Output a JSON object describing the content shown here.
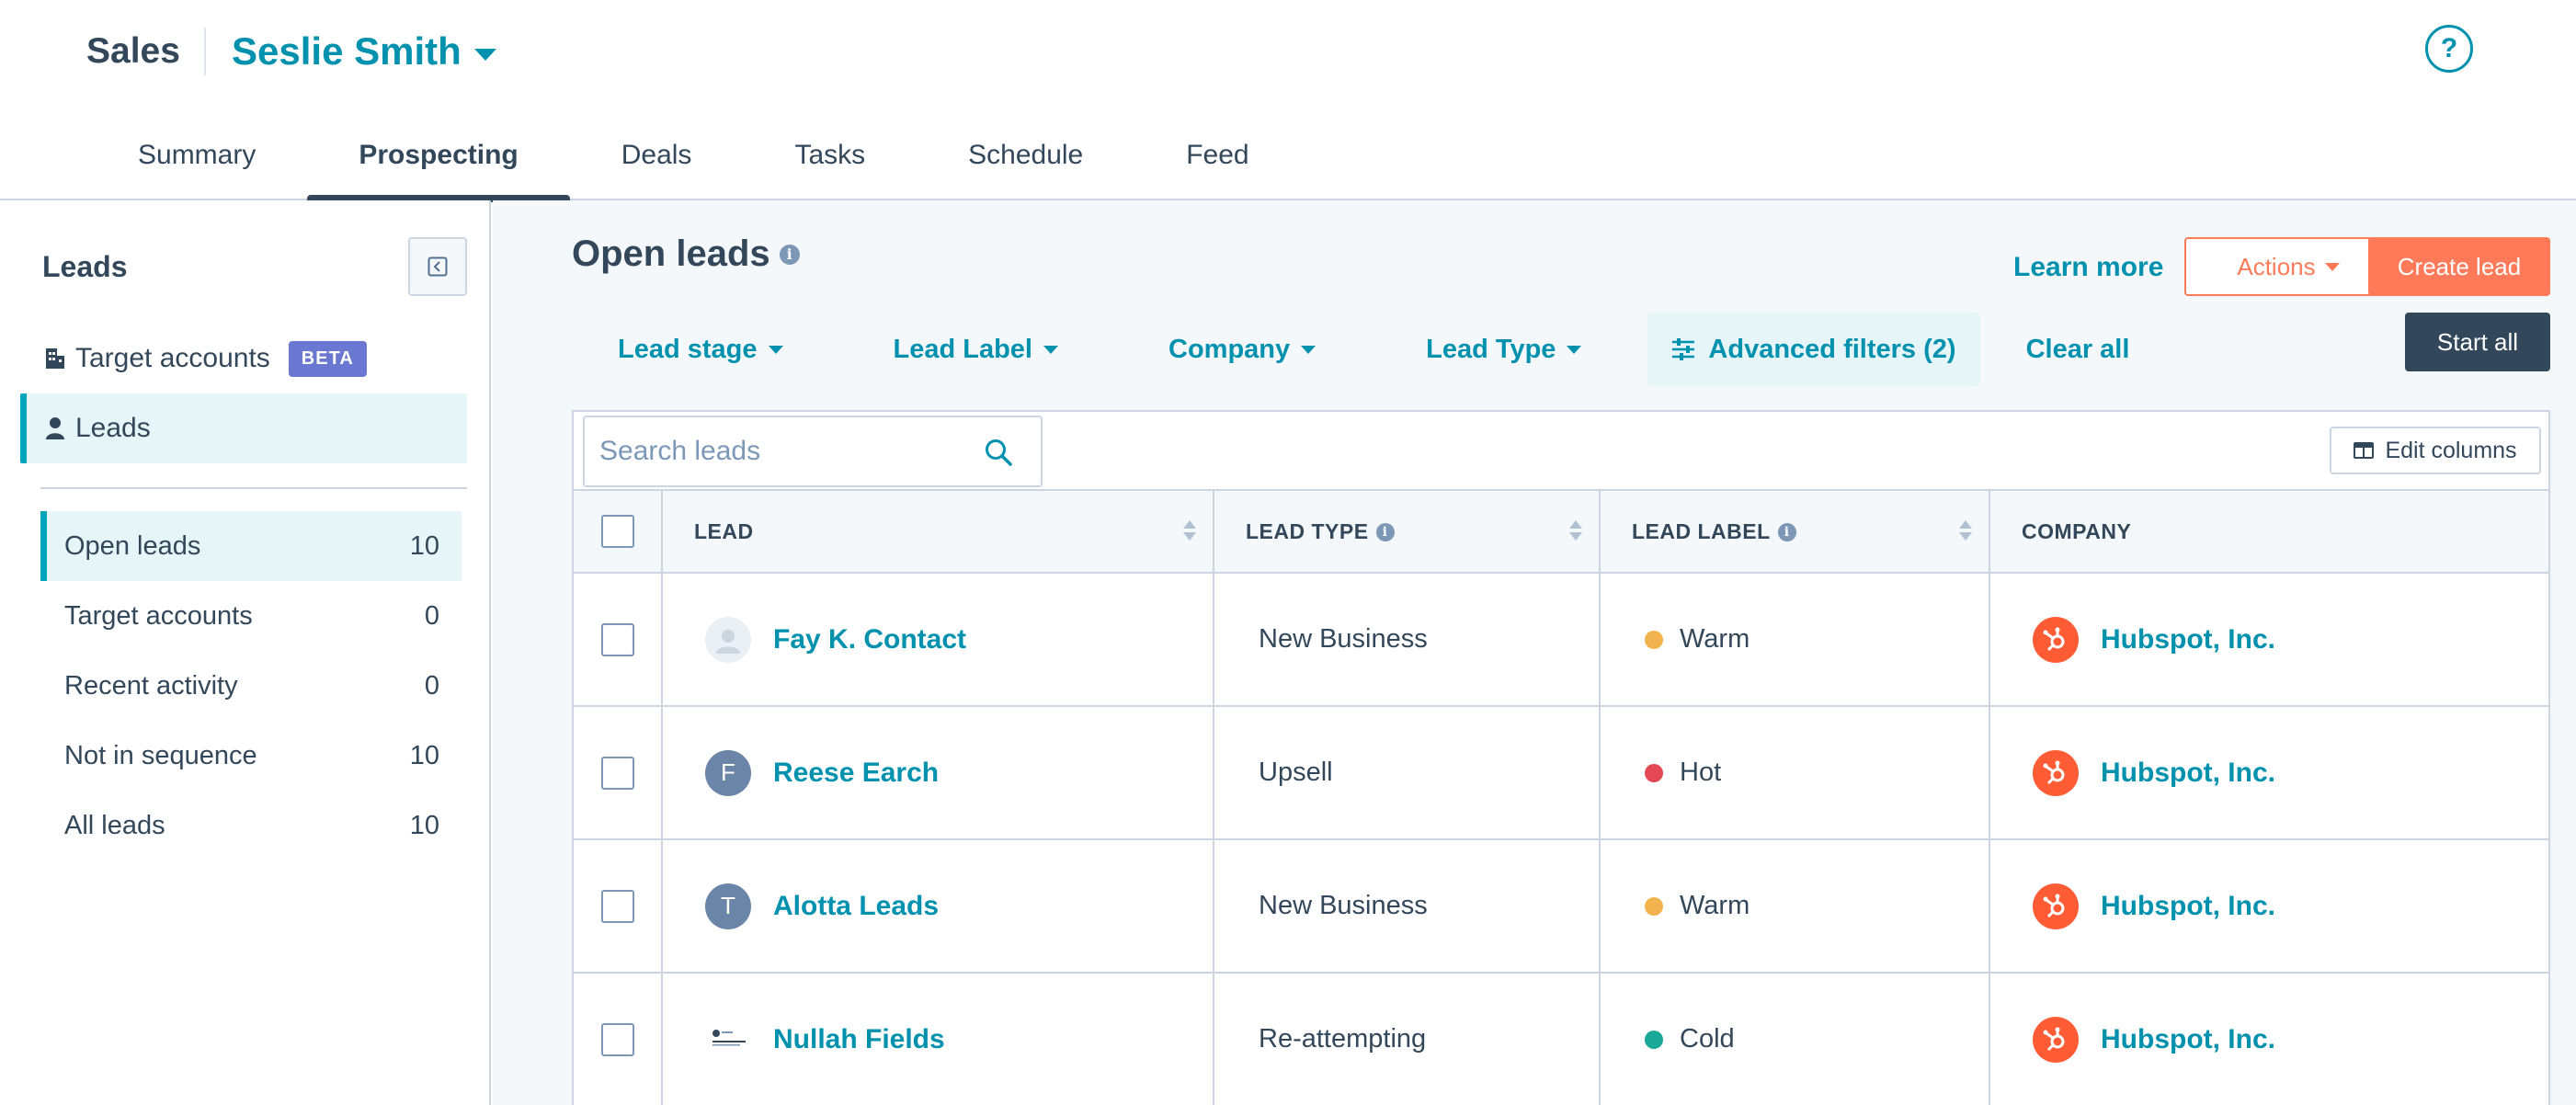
{
  "header": {
    "app_title": "Sales",
    "user_name": "Seslie Smith",
    "help_label": "?",
    "tabs": [
      {
        "label": "Summary",
        "active": false
      },
      {
        "label": "Prospecting",
        "active": true
      },
      {
        "label": "Deals",
        "active": false
      },
      {
        "label": "Tasks",
        "active": false
      },
      {
        "label": "Schedule",
        "active": false
      },
      {
        "label": "Feed",
        "active": false
      }
    ]
  },
  "sidebar": {
    "title": "Leads",
    "nav": [
      {
        "label": "Target accounts",
        "badge": "BETA",
        "icon": "building-icon"
      },
      {
        "label": "Leads",
        "icon": "person-icon",
        "active": true
      }
    ],
    "views": [
      {
        "label": "Open leads",
        "count": "10",
        "active": true
      },
      {
        "label": "Target accounts",
        "count": "0"
      },
      {
        "label": "Recent activity",
        "count": "0"
      },
      {
        "label": "Not in sequence",
        "count": "10"
      },
      {
        "label": "All leads",
        "count": "10"
      }
    ]
  },
  "main": {
    "title": "Open leads",
    "learn_more": "Learn more",
    "actions_label": "Actions",
    "create_label": "Create lead",
    "start_label": "Start all",
    "filters": [
      "Lead stage",
      "Lead Label",
      "Company",
      "Lead Type"
    ],
    "advanced_filters": "Advanced filters (2)",
    "clear_all": "Clear all",
    "search_placeholder": "Search leads",
    "edit_columns": "Edit columns",
    "columns": [
      "LEAD",
      "LEAD TYPE",
      "LEAD LABEL",
      "COMPANY"
    ],
    "rows": [
      {
        "name": "Fay K. Contact",
        "avatar": "",
        "avatar_kind": "blank",
        "type": "New Business",
        "label": "Warm",
        "label_color": "#f2b24e",
        "company": "Hubspot, Inc."
      },
      {
        "name": "Reese Earch",
        "avatar": "F",
        "avatar_kind": "initial",
        "type": "Upsell",
        "label": "Hot",
        "label_color": "#e44855",
        "company": "Hubspot, Inc."
      },
      {
        "name": "Alotta Leads",
        "avatar": "T",
        "avatar_kind": "initial",
        "type": "New Business",
        "label": "Warm",
        "label_color": "#f2b24e",
        "company": "Hubspot, Inc."
      },
      {
        "name": "Nullah Fields",
        "avatar": "",
        "avatar_kind": "logo",
        "type": "Re-attempting",
        "label": "Cold",
        "label_color": "#1aa899",
        "company": "Hubspot, Inc."
      }
    ]
  },
  "colors": {
    "accent": "#0091ae",
    "primary_button": "#ff7a59",
    "dark_button": "#33475b",
    "hubspot_orange": "#ff5c35"
  }
}
